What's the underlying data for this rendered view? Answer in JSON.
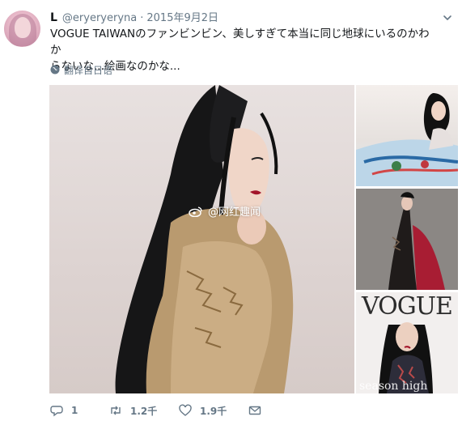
{
  "tweet": {
    "display_name": "L",
    "handle": "@eryeryeryna",
    "separator": "·",
    "date": "2015年9月2日",
    "text_line1": "VOGUE TAIWANのファンビンビン、美しすぎて本当に同じ地球にいるのかわか",
    "text_line2": "らないな...絵画なのかな...",
    "translate_label": "翻译自日语"
  },
  "media": {
    "watermark": "@网红趣闻",
    "vogue_text": "VOGUE",
    "season_text": "season high"
  },
  "actions": {
    "reply_count": "1",
    "retweet_count": "1.2千",
    "like_count": "1.9千"
  },
  "colors": {
    "text": "#14171a",
    "muted": "#657786"
  },
  "icons": [
    "avatar",
    "chevron-down-icon",
    "globe-icon",
    "weibo-icon",
    "reply-icon",
    "retweet-icon",
    "like-icon",
    "message-icon"
  ]
}
